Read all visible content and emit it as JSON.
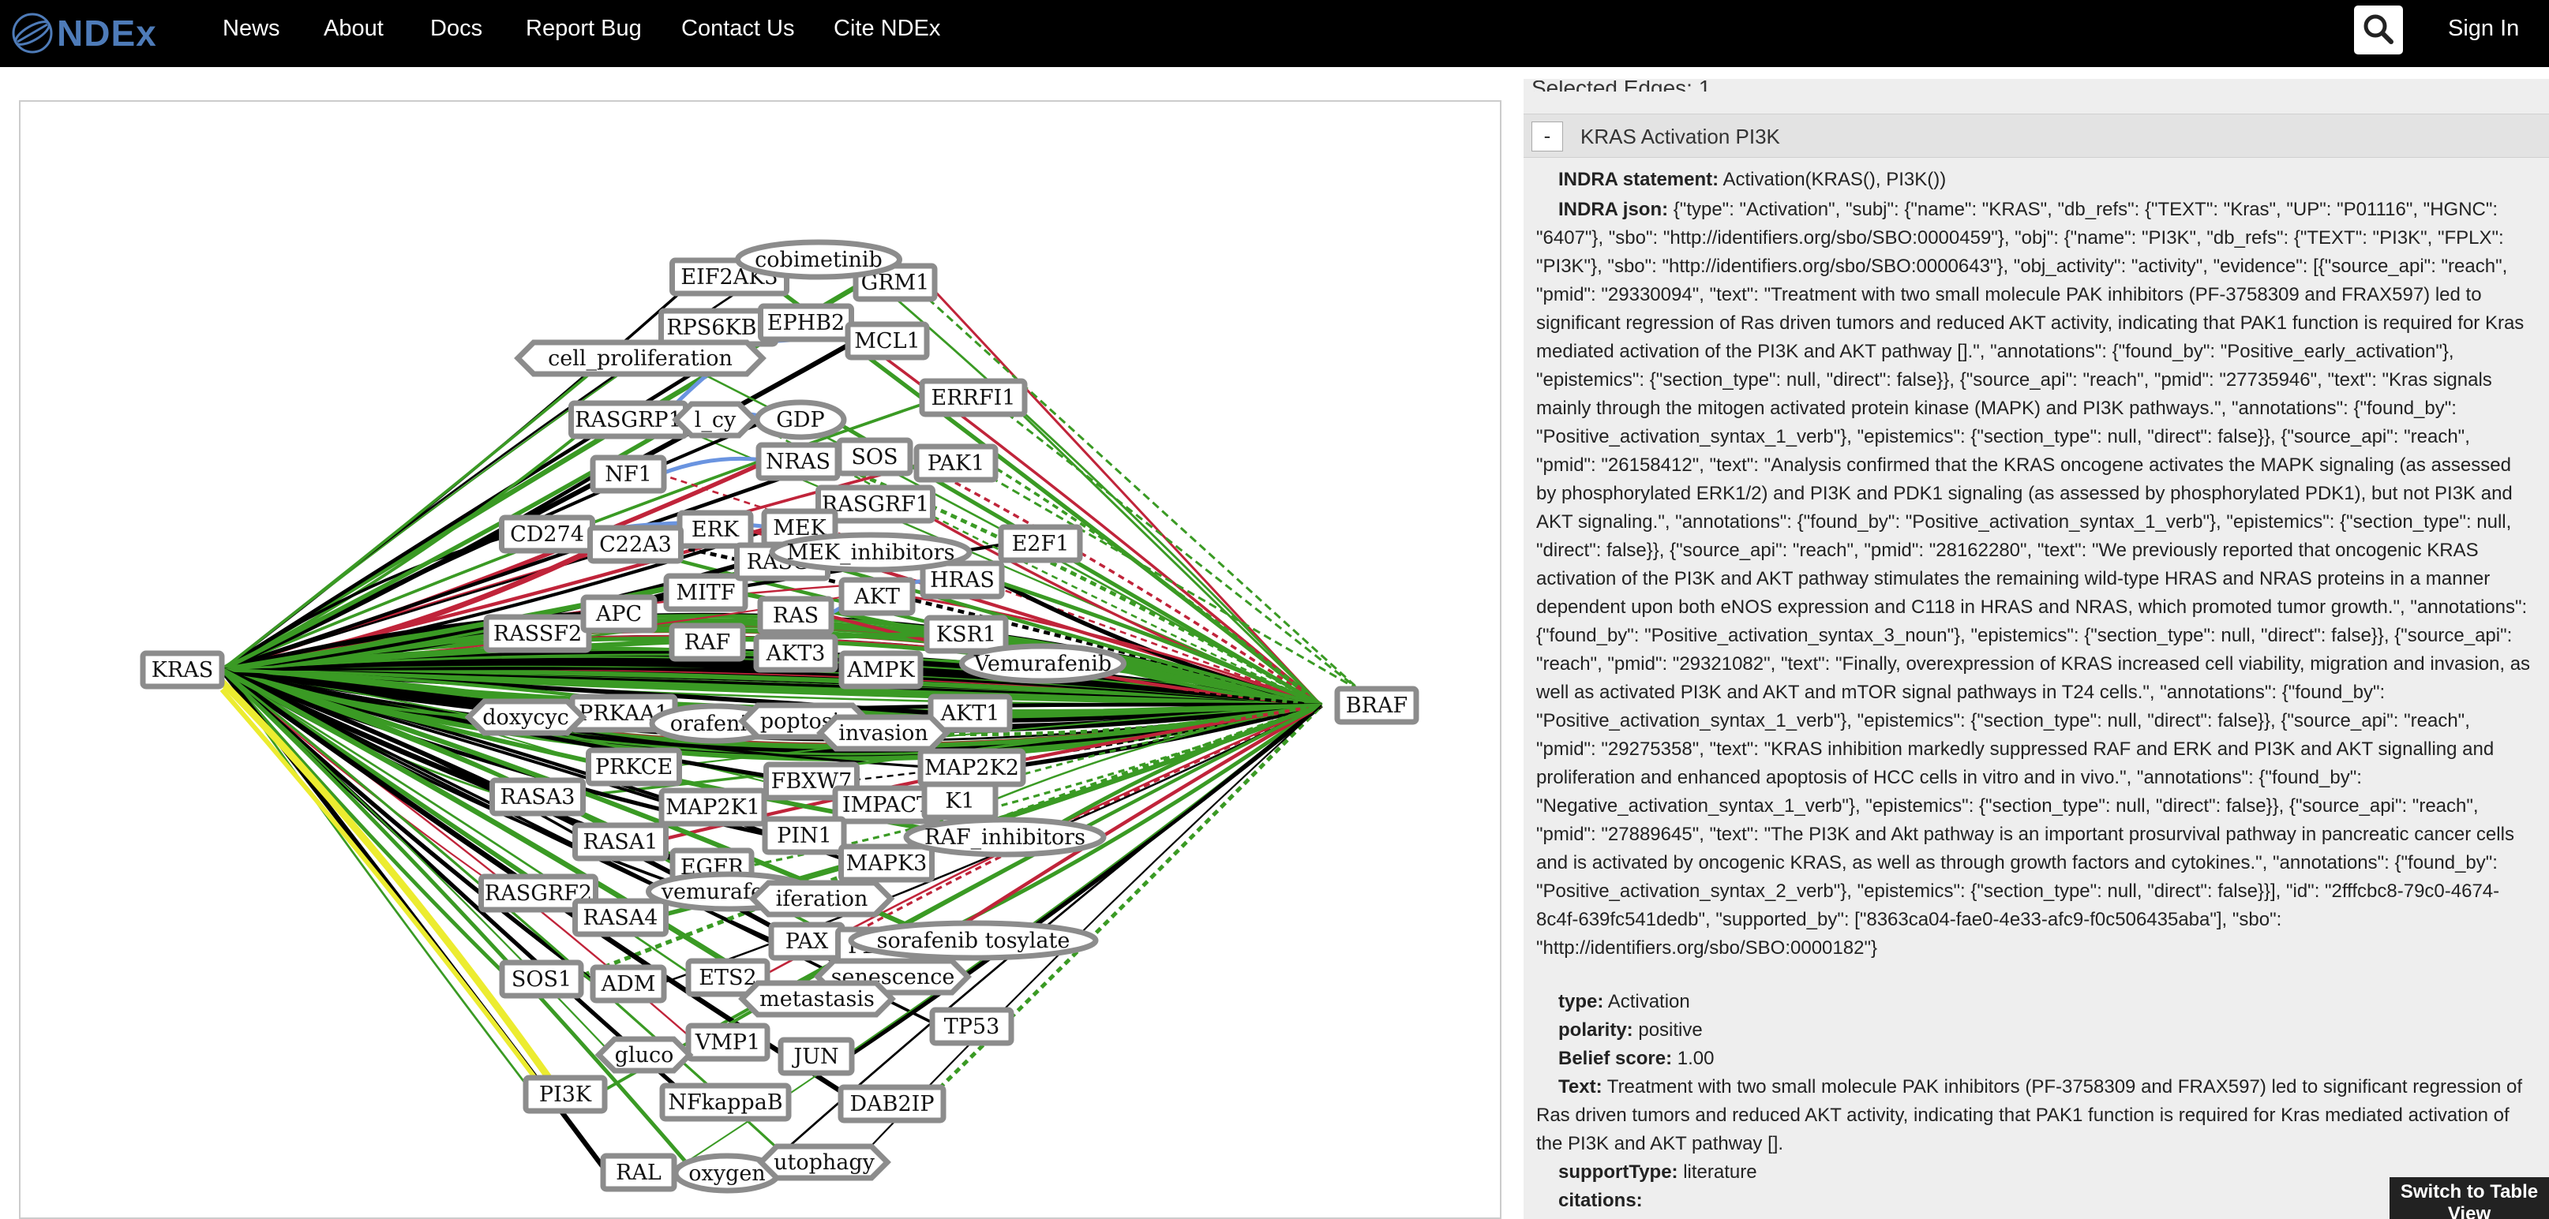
{
  "navbar": {
    "logo_text": "NDEx",
    "links": [
      "News",
      "About",
      "Docs",
      "Report Bug",
      "Contact Us",
      "Cite NDEx"
    ],
    "search_icon": "search-icon",
    "sign_in": "Sign In",
    "colors": {
      "background": "#000000",
      "logo": "#4e7bb8"
    }
  },
  "network": {
    "source": "KRAS",
    "target": "BRAF",
    "edge_colors": {
      "black": "#000000",
      "green": "#3a9a24",
      "red": "#c0243a",
      "blue": "#6a94e0",
      "yellow": "#ecec30"
    },
    "rect_nodes": [
      "KRAS",
      "BRAF",
      "EIF2AK3",
      "GRM1",
      "RPS6KB2",
      "EPHB2",
      "MCL1",
      "ERRFI1",
      "RASGRP1",
      "NF1",
      "NRAS",
      "PAK1",
      "SOS",
      "RASGRF1",
      "CD274",
      "ERK",
      "MEK",
      "E2F1",
      "HRAS",
      "MITF",
      "RAS",
      "AKT",
      "RASSF2",
      "RAF",
      "AKT3",
      "KSR1",
      "AMPK",
      "PRKAA1",
      "AKT1",
      "PRKCE",
      "FBXW7",
      "MAP2K2",
      "RASA3",
      "MAP2K1",
      "IMPACT",
      "K1",
      "PIN1",
      "RASA1",
      "MAPK3",
      "EGFR",
      "RASGRF2",
      "RASA4",
      "PAX",
      "PLX40",
      "SOS1",
      "ADM",
      "ETS2",
      "TP53",
      "VMP1",
      "JUN",
      "PI3K",
      "NFkappaB",
      "DAB2IP",
      "RAL",
      "C22A3",
      "APC",
      "RASGI"
    ],
    "ellipse_nodes": [
      "cobimetinib",
      "GDP",
      "Vemurafenib",
      "orafenib",
      "vemurafenib",
      "sorafenib tosylate",
      "oxygen",
      "RAF_inhibitors",
      "MEK_inhibitors"
    ],
    "hexagon_nodes": [
      "cell_proliferation",
      "l_cy",
      "doxycyc",
      "poptosis",
      "invasion",
      "iferation",
      "senescence",
      "metastasis",
      "gluco",
      "utophagy"
    ]
  },
  "details": {
    "selected_edges_label": "Selected Edges: 1",
    "edge_title": "KRAS Activation PI3K",
    "collapse_symbol": "-",
    "indra_statement_label": "INDRA statement:",
    "indra_statement": "Activation(KRAS(), PI3K())",
    "indra_json_label": "INDRA json:",
    "indra_json": "{\"type\": \"Activation\", \"subj\": {\"name\": \"KRAS\", \"db_refs\": {\"TEXT\": \"Kras\", \"UP\": \"P01116\", \"HGNC\": \"6407\"}, \"sbo\": \"http://identifiers.org/sbo/SBO:0000459\"}, \"obj\": {\"name\": \"PI3K\", \"db_refs\": {\"TEXT\": \"PI3K\", \"FPLX\": \"PI3K\"}, \"sbo\": \"http://identifiers.org/sbo/SBO:0000643\"}, \"obj_activity\": \"activity\", \"evidence\": [{\"source_api\": \"reach\", \"pmid\": \"29330094\", \"text\": \"Treatment with two small molecule PAK inhibitors (PF-3758309 and FRAX597) led to significant regression of Ras driven tumors and reduced AKT activity, indicating that PAK1 function is required for Kras mediated activation of the PI3K and AKT pathway [].\", \"annotations\": {\"found_by\": \"Positive_early_activation\"}, \"epistemics\": {\"section_type\": null, \"direct\": false}}, {\"source_api\": \"reach\", \"pmid\": \"27735946\", \"text\": \"Kras signals mainly through the mitogen activated protein kinase (MAPK) and PI3K pathways.\", \"annotations\": {\"found_by\": \"Positive_activation_syntax_1_verb\"}, \"epistemics\": {\"section_type\": null, \"direct\": false}}, {\"source_api\": \"reach\", \"pmid\": \"26158412\", \"text\": \"Analysis confirmed that the KRAS oncogene activates the MAPK signaling (as assessed by phosphorylated ERK1/2) and PI3K and PDK1 signaling (as assessed by phosphorylated PDK1), but not PI3K and AKT signaling.\", \"annotations\": {\"found_by\": \"Positive_activation_syntax_1_verb\"}, \"epistemics\": {\"section_type\": null, \"direct\": false}}, {\"source_api\": \"reach\", \"pmid\": \"28162280\", \"text\": \"We previously reported that oncogenic KRAS activation of the PI3K and AKT pathway stimulates the remaining wild-type HRAS and NRAS proteins in a manner dependent upon both eNOS expression and C118 in HRAS and NRAS, which promoted tumor growth.\", \"annotations\": {\"found_by\": \"Positive_activation_syntax_3_noun\"}, \"epistemics\": {\"section_type\": null, \"direct\": false}}, {\"source_api\": \"reach\", \"pmid\": \"29321082\", \"text\": \"Finally, overexpression of KRAS increased cell viability, migration and invasion, as well as activated PI3K and AKT and mTOR signal pathways in T24 cells.\", \"annotations\": {\"found_by\": \"Positive_activation_syntax_1_verb\"}, \"epistemics\": {\"section_type\": null, \"direct\": false}}, {\"source_api\": \"reach\", \"pmid\": \"29275358\", \"text\": \"KRAS inhibition markedly suppressed RAF and ERK and PI3K and AKT signalling and proliferation and enhanced apoptosis of HCC cells in vitro and in vivo.\", \"annotations\": {\"found_by\": \"Negative_activation_syntax_1_verb\"}, \"epistemics\": {\"section_type\": null, \"direct\": false}}, {\"source_api\": \"reach\", \"pmid\": \"27889645\", \"text\": \"The PI3K and Akt pathway is an important prosurvival pathway in pancreatic cancer cells and is activated by oncogenic KRAS, as well as through growth factors and cytokines.\", \"annotations\": {\"found_by\": \"Positive_activation_syntax_2_verb\"}, \"epistemics\": {\"section_type\": null, \"direct\": false}}], \"id\": \"2fffcbc8-79c0-4674-8c4f-639fc541dedb\", \"supported_by\": [\"8363ca04-fae0-4e33-afc9-f0c506435aba\"], \"sbo\": \"http://identifiers.org/sbo/SBO:0000182\"}",
    "type_label": "type:",
    "type_value": "Activation",
    "polarity_label": "polarity:",
    "polarity_value": "positive",
    "belief_label": "Belief score:",
    "belief_value": "1.00",
    "text_label": "Text:",
    "text_value": "Treatment with two small molecule PAK inhibitors (PF-3758309 and FRAX597) led to significant regression of Ras driven tumors and reduced AKT activity, indicating that PAK1 function is required for Kras mediated activation of the PI3K and AKT pathway [].",
    "support_type_label": "supportType:",
    "support_type_value": "literature",
    "citations_label": "citations:"
  },
  "switch_table_button": "Switch to Table View"
}
